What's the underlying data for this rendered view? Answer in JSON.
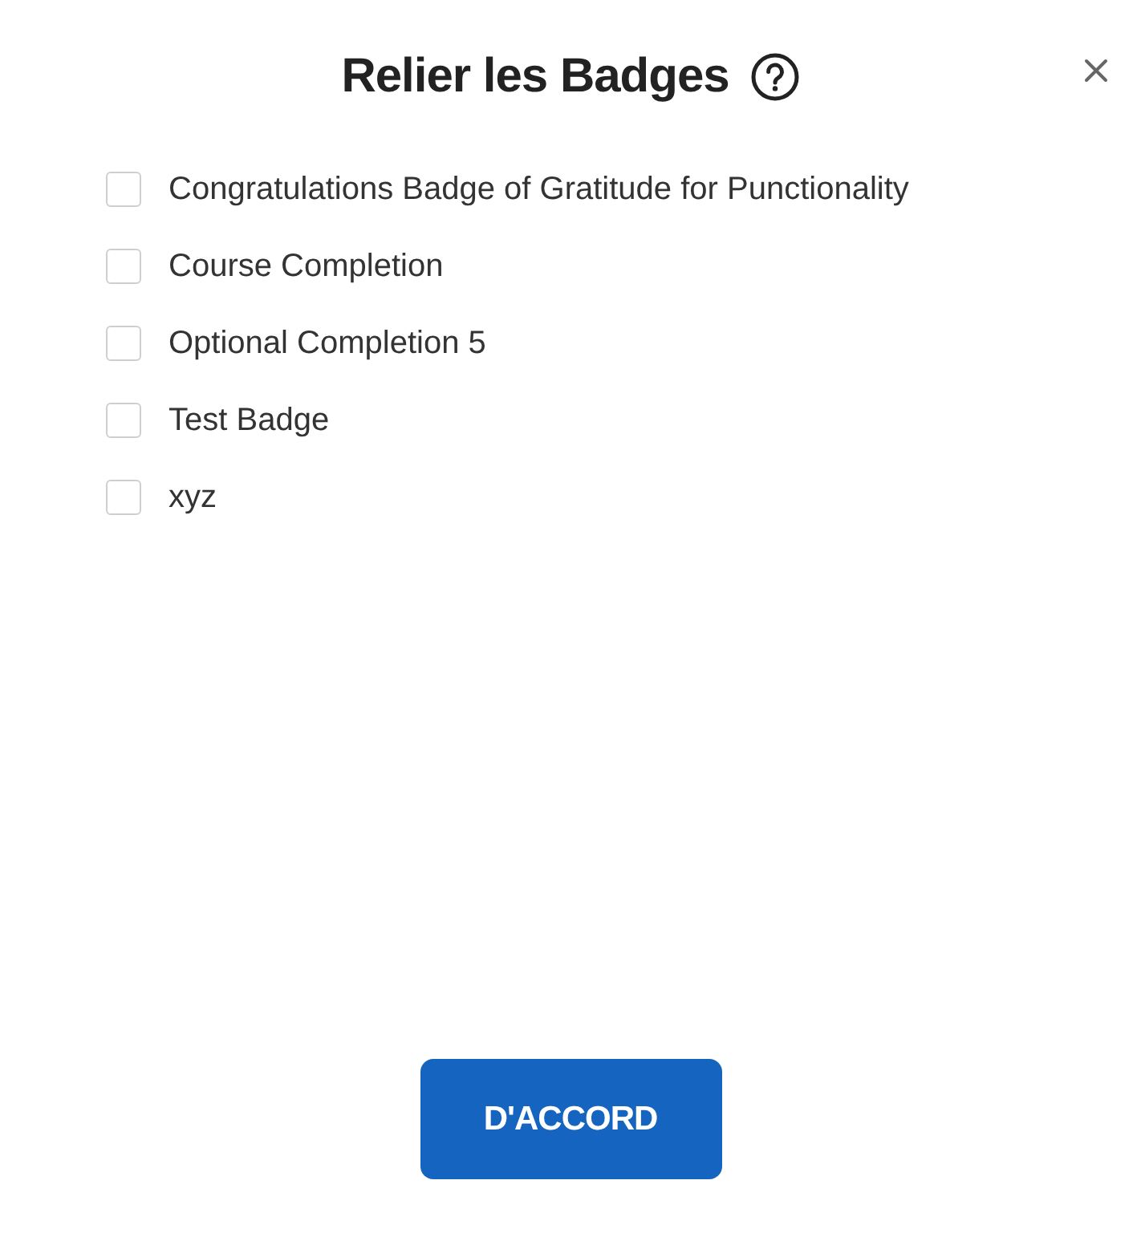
{
  "dialog": {
    "title": "Relier les Badges",
    "badges": [
      {
        "label": "Congratulations Badge of Gratitude for Punctionality",
        "checked": false
      },
      {
        "label": "Course Completion",
        "checked": false
      },
      {
        "label": "Optional Completion 5",
        "checked": false
      },
      {
        "label": "Test Badge",
        "checked": false
      },
      {
        "label": "xyz",
        "checked": false
      }
    ],
    "buttons": [
      {
        "label": "D'ACCORD",
        "kind": "primary"
      }
    ]
  }
}
